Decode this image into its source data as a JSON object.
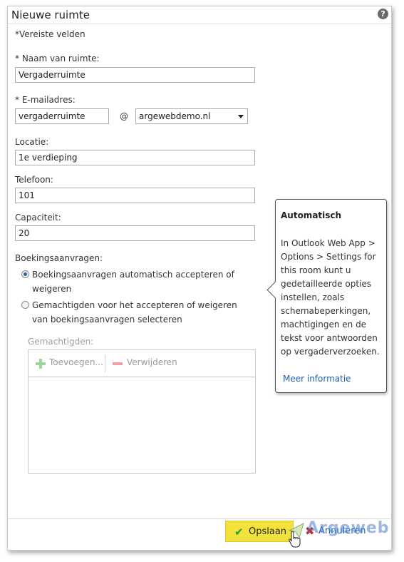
{
  "dialog": {
    "title": "Nieuwe ruimte",
    "help_glyph": "?"
  },
  "form": {
    "required_note": "*Vereiste velden",
    "name_label": "* Naam van ruimte:",
    "name_value": "Vergaderruimte",
    "email_label": "* E-mailadres:",
    "email_value": "vergaderruimte",
    "at_sign": "@",
    "domain_value": "argewebdemo.nl",
    "location_label": "Locatie:",
    "location_value": "1e verdieping",
    "phone_label": "Telefoon:",
    "phone_value": "101",
    "capacity_label": "Capaciteit:",
    "capacity_value": "20",
    "booking_label": "Boekingsaanvragen:",
    "booking_options": [
      {
        "line1": "Boekingsaanvragen automatisch accepteren of",
        "line2": "weigeren",
        "selected": true
      },
      {
        "line1": "Gemachtigden voor het accepteren of weigeren",
        "line2": "van boekingsaanvragen selecteren",
        "selected": false
      }
    ],
    "delegates_label": "Gemachtigden:",
    "add_label": "Toevoegen...",
    "remove_label": "Verwijderen"
  },
  "tooltip": {
    "title": "Automatisch",
    "body": "In Outlook Web App > Options > Settings for this room kunt u gedetailleerde opties instellen, zoals schemabeperkingen, machtigingen en de tekst voor antwoorden op vergaderverzoeken.",
    "link": "Meer informatie"
  },
  "footer": {
    "save_label": "Opslaan",
    "cancel_label": "Annuleren"
  },
  "watermark": {
    "text": "Argeweb"
  },
  "colors": {
    "save_button": "#f3e23a",
    "link": "#1e5fb4",
    "cancel_x": "#d02020"
  }
}
